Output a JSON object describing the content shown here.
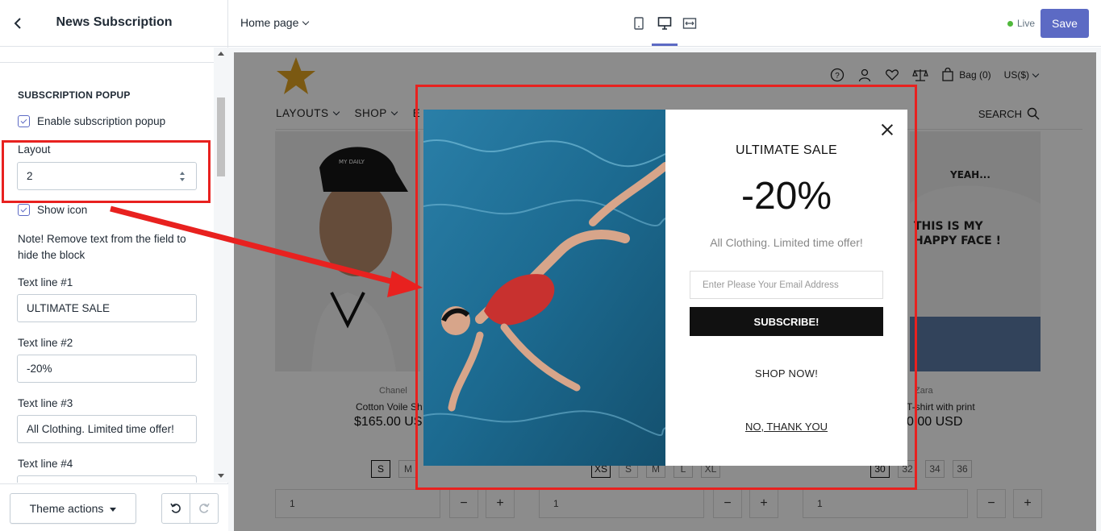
{
  "sidebar": {
    "title": "News Subscription",
    "section_title": "SUBSCRIPTION POPUP",
    "enable_label": "Enable subscription popup",
    "layout_label": "Layout",
    "layout_value": "2",
    "show_icon_label": "Show icon",
    "note": "Note! Remove text from the field to hide the block",
    "text_line_1_label": "Text line #1",
    "text_line_1_value": "ULTIMATE SALE",
    "text_line_2_label": "Text line #2",
    "text_line_2_value": "-20%",
    "text_line_3_label": "Text line #3",
    "text_line_3_value": "All Clothing. Limited time offer!",
    "text_line_4_label": "Text line #4",
    "text_line_4_value": "",
    "theme_actions_label": "Theme actions"
  },
  "topbar": {
    "page_selector": "Home page",
    "live_label": "Live",
    "save_label": "Save"
  },
  "store": {
    "nav": [
      "LAYOUTS",
      "SHOP",
      "E"
    ],
    "search_label": "SEARCH",
    "bag_label": "Bag (0)",
    "currency_label": "US($)",
    "products": [
      {
        "brand": "Chanel",
        "name": "Cotton Voile Sh",
        "price": "$165.00 US"
      },
      {
        "brand": "Zara",
        "name": "T-shirt with print",
        "price": "0.00 USD"
      }
    ],
    "sizes_left": [
      "S",
      "M"
    ],
    "sizes_mid": [
      "XS",
      "S",
      "M",
      "L",
      "XL"
    ],
    "sizes_right": [
      "30",
      "32",
      "34",
      "36"
    ],
    "qty": "1",
    "tshirt_text_1": "YEAH...",
    "tshirt_text_2": "THIS IS MY",
    "tshirt_text_3": "HAPPY FACE !",
    "cap_text": "MY DAILY"
  },
  "popup": {
    "line1": "ULTIMATE SALE",
    "line2": "-20%",
    "line3": "All Clothing. Limited time offer!",
    "email_placeholder": "Enter Please Your Email Address",
    "subscribe_label": "SUBSCRIBE!",
    "shop_now_label": "SHOP NOW!",
    "no_thanks_label": "NO, THANK YOU"
  },
  "colors": {
    "accent": "#5c6ac4",
    "live": "#50b83c",
    "annotation": "#e8211f",
    "logo": "#e0a321"
  }
}
